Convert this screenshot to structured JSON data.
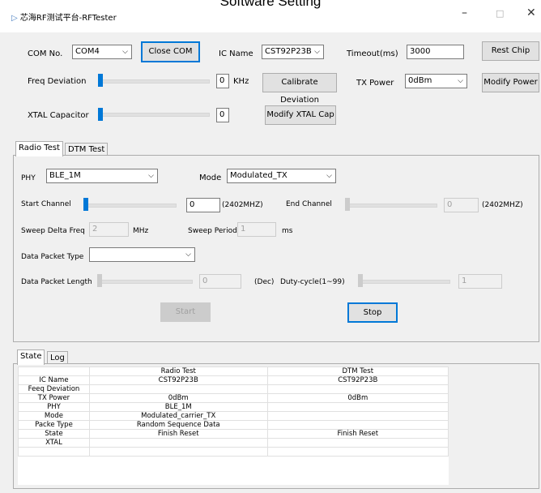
{
  "overlay_title": "Software Setting",
  "window": {
    "title": "芯海RF测试平台-RFTester",
    "minimize": "–",
    "maximize": "□",
    "close": "✕"
  },
  "top": {
    "com_label": "COM No.",
    "com_value": "COM4",
    "close_com": "Close COM",
    "ic_label": "IC Name",
    "ic_value": "CST92P23B",
    "timeout_label": "Timeout(ms)",
    "timeout_value": "3000",
    "rest_chip": "Rest Chip",
    "freq_label": "Freq Deviation",
    "freq_value": "0",
    "freq_unit": "KHz",
    "calibrate": "Calibrate Deviation",
    "tx_label": "TX Power",
    "tx_value": "0dBm",
    "modify_power": "Modify Power",
    "xtal_label": "XTAL Capacitor",
    "xtal_value": "0",
    "modify_xtal": "Modify XTAL Cap"
  },
  "tabs": {
    "radio": "Radio Test",
    "dtm": "DTM Test"
  },
  "radio": {
    "phy_label": "PHY",
    "phy_value": "BLE_1M",
    "mode_label": "Mode",
    "mode_value": "Modulated_TX",
    "start_label": "Start Channel",
    "start_value": "0",
    "start_freq": "(2402MHZ)",
    "end_label": "End Channel",
    "end_value": "0",
    "end_freq": "(2402MHZ)",
    "sweep_delta_label": "Sweep Delta Freq",
    "sweep_delta_value": "2",
    "sweep_delta_unit": "MHz",
    "sweep_period_label": "Sweep Period",
    "sweep_period_value": "1",
    "sweep_period_unit": "ms",
    "packet_type_label": "Data Packet Type",
    "packet_type_value": "",
    "packet_len_label": "Data Packet Length",
    "packet_len_value": "0",
    "packet_len_unit": "(Dec)",
    "duty_label": "Duty-cycle(1~99)",
    "duty_value": "1",
    "start_btn": "Start",
    "stop_btn": "Stop"
  },
  "state_tabs": {
    "state": "State",
    "log": "Log"
  },
  "state_table": {
    "headers": [
      "",
      "Radio Test",
      "DTM Test"
    ],
    "rows": [
      [
        "IC Name",
        "CST92P23B",
        "CST92P23B"
      ],
      [
        "Feeq Deviation",
        "",
        ""
      ],
      [
        "TX Power",
        "0dBm",
        "0dBm"
      ],
      [
        "PHY",
        "BLE_1M",
        ""
      ],
      [
        "Mode",
        "Modulated_carrier_TX",
        ""
      ],
      [
        "Packe Type",
        "Random Sequence Data",
        ""
      ],
      [
        "State",
        "Finish Reset",
        "Finish Reset"
      ],
      [
        "XTAL",
        "",
        ""
      ],
      [
        "",
        "",
        ""
      ]
    ]
  },
  "colors": {
    "accent": "#0078d7"
  }
}
